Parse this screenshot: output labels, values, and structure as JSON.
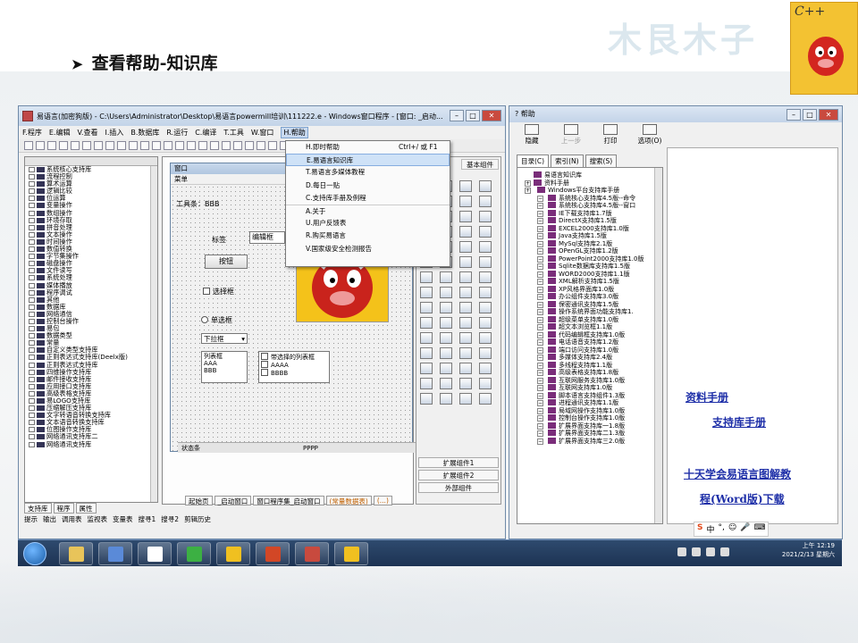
{
  "slide": {
    "title": "查看帮助-知识库",
    "brand_text": "木艮木子",
    "logo_text": "C++"
  },
  "ide": {
    "window_title": "易语言(加密狗版) - C:\\Users\\Administrator\\Desktop\\易语言powermill培训\\111222.e - Windows窗口程序 - [窗口: _启动...",
    "menu": [
      "F.程序",
      "E.编辑",
      "V.查看",
      "I.插入",
      "B.数据库",
      "R.运行",
      "C.编译",
      "T.工具",
      "W.窗口",
      "H.帮助"
    ],
    "tree_items": [
      "系统核心支持库",
      "流程控制",
      "算术运算",
      "逻辑比较",
      "位运算",
      "变量操作",
      "数组操作",
      "环境存取",
      "拼音处理",
      "文本操作",
      "时间操作",
      "数值转换",
      "字节集操作",
      "磁盘操作",
      "文件读写",
      "系统处理",
      "媒体播放",
      "程序调试",
      "其他",
      "数据库",
      "网络通信",
      "控制台操作",
      "易包",
      "数据类型",
      "常量",
      "自定义类型支持库",
      "正则表达式支持库(Deelx版)",
      "正则表达式支持库",
      "四维操作支持库",
      "邮件接收支持库",
      "应用接口支持库",
      "高级表格支持库",
      "易LOGO支持库",
      "压缩解压支持库",
      "文字转语音转换支持库",
      "文本语音转换支持库",
      "位图操作支持库",
      "网络通讯支持库二",
      "网络通讯支持库"
    ],
    "left_tabs": [
      "支持库",
      "程序",
      "属性"
    ],
    "form": {
      "title": "窗口",
      "menu": "菜单",
      "toolbar_label": "工具条",
      "toolbar_value": "BBB",
      "label_text": "标签",
      "edit_text": "编辑框",
      "button_text": "按钮",
      "checkbox_text": "选择框",
      "radio_text": "单选框",
      "combo_text": "下拉框",
      "listbox_title": "列表框",
      "listbox_items": [
        "AAA",
        "BBB"
      ],
      "checklist_title": "带选择的列表框",
      "checklist_items": [
        "AAAA",
        "BBBB"
      ],
      "status_left": "状态条",
      "status_right": "PPPP"
    },
    "palette_header": "基本组件",
    "palette_buttons": [
      "扩展组件1",
      "扩展组件2",
      "外部组件"
    ],
    "design_tabs": [
      "起始页",
      "_启动窗口",
      "窗口程序集_启动窗口",
      "(常量数据表)",
      "(...)"
    ],
    "bottom_tabs": [
      "提示",
      "输出",
      "调用表",
      "监视表",
      "变量表",
      "搜寻1",
      "搜寻2",
      "剪辑历史"
    ],
    "help_menu": [
      {
        "label": "H.即时帮助",
        "shortcut": "Ctrl+/ 或 F1"
      },
      {
        "label": "E.易语言知识库",
        "shortcut": ""
      },
      {
        "label": "T.易语言多媒体教程",
        "shortcut": ""
      },
      {
        "label": "D.每日一贴",
        "shortcut": ""
      },
      {
        "label": "C.支持库手册及例程",
        "shortcut": ""
      },
      {
        "label": "A.关于",
        "shortcut": ""
      },
      {
        "label": "U.用户反馈表",
        "shortcut": ""
      },
      {
        "label": "R.购买易语言",
        "shortcut": ""
      },
      {
        "label": "V.国家级安全检测报告",
        "shortcut": ""
      }
    ],
    "help_menu_highlight_index": 1
  },
  "help": {
    "window_title": "帮助",
    "toolbar": [
      {
        "label": "隐藏",
        "icon": "hide-icon",
        "enabled": true
      },
      {
        "label": "上一步",
        "icon": "back-icon",
        "enabled": false
      },
      {
        "label": "打印",
        "icon": "print-icon",
        "enabled": true
      },
      {
        "label": "选项(O)",
        "icon": "options-icon",
        "enabled": true
      }
    ],
    "tabs": [
      "目录(C)",
      "索引(N)",
      "搜索(S)"
    ],
    "tree": [
      "易语言知识库",
      "资料手册",
      "Windows平台支持库手册",
      "系统核心支持库4.5版--命令",
      "系统核心支持库4.5版--窗口",
      "IE下载支持库1.7版",
      "DirectX支持库1.5版",
      "EXCEL2000支持库1.0版",
      "Java支持库1.5版",
      "MySql支持库2.1版",
      "OPenGL支持库1.2版",
      "PowerPoint2000支持库1.0版",
      "Sqlite数据库支持库1.5版",
      "WORD2000支持库1.1版",
      "XML解析支持库1.5版",
      "XP风格界面库1.0版",
      "办公组件支持库3.0版",
      "保密通讯支持库1.5版",
      "操作系统界面功能支持库1.",
      "超级菜单支持库1.0版",
      "超文本浏览框1.1版",
      "代码编辑框支持库1.0版",
      "电话语音支持库1.2版",
      "端口访问支持库1.0版",
      "多媒体支持库2.4版",
      "多线程支持库1.1版",
      "高级表格支持库1.8版",
      "互联网服务支持库1.0版",
      "互联网支持库1.0版",
      "脚本语言支持组件1.3版",
      "进程通讯支持库1.1版",
      "局域网操作支持库1.0版",
      "控制台操作支持库1.0版",
      "扩展界面支持库一1.8版",
      "扩展界面支持库二1.3版",
      "扩展界面支持库三2.0版"
    ],
    "links": [
      "资料手册",
      "支持库手册",
      "十天学会易语言图解教",
      "程(Word版)下载"
    ]
  },
  "taskbar": {
    "time": "上午 12:19",
    "date": "2021/2/13 星期六",
    "ime": [
      "中",
      "°,"
    ]
  },
  "colors": {
    "link": "#1e2fa8",
    "taskbar": "#1d3353",
    "menu_highlight": "#cfe2f7"
  }
}
